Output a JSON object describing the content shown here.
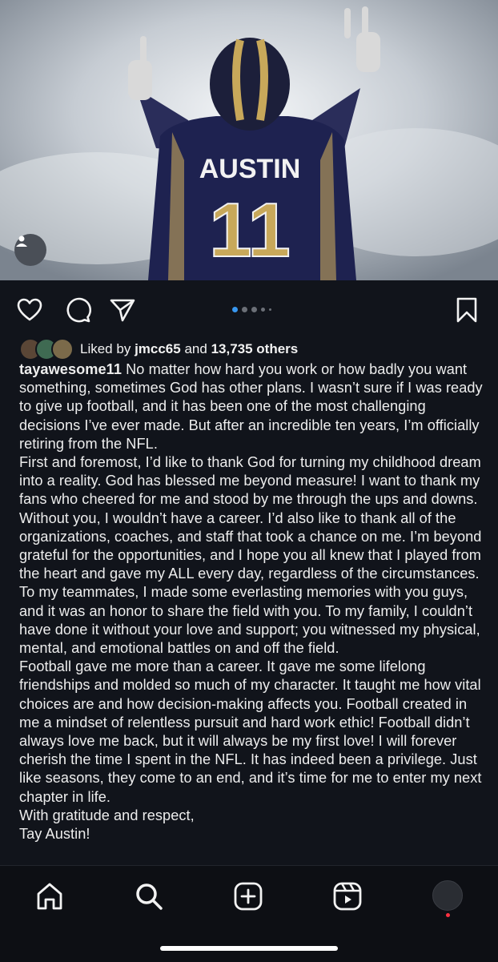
{
  "post": {
    "likes": {
      "prefix": "Liked by",
      "user": "jmcc65",
      "connector": "and",
      "others": "13,735 others"
    },
    "carousel": {
      "total_slides": 5,
      "active_index": 0
    },
    "caption": {
      "username": "tayawesome11",
      "first_paragraph": " No matter how hard you work or how badly you want something, sometimes God has other plans. I wasn’t sure if I was ready to give up football, and it has been one of the most challenging decisions I’ve ever made. But after an incredible ten years, I’m officially retiring from the NFL.",
      "paragraph_2": "First and foremost, I’d like to thank God for turning my childhood dream into a reality. God has blessed me beyond measure! I want to thank my fans who cheered for me and stood by me through the ups and downs. Without you, I wouldn’t have a career.  I’d also like to thank all of the organizations, coaches, and staff that took a chance on me. I’m beyond grateful for the opportunities, and I hope you all knew that I played from the heart and gave my ALL every day, regardless of the circumstances. To my teammates, I made some everlasting memories with you guys, and it was an honor to share the field with you. To my family, I couldn’t have done it without your love and support; you witnessed my physical, mental, and emotional battles on and off the field.",
      "paragraph_3": " Football gave me more than a career. It gave me some lifelong friendships and molded so much of my character. It taught me how vital choices are and how decision-making affects you. Football created in me a mindset of relentless pursuit and hard work ethic! Football didn’t always love me back, but it will always be my first love!  I will forever cherish the time I spent in the NFL. It has indeed been a privilege. Just like seasons, they come to an end, and it’s time for me to enter my next chapter in life.",
      "closing": "With gratitude and respect,",
      "signature": "Tay Austin!"
    },
    "photo": {
      "jersey_name": "AUSTIN",
      "jersey_number": "11"
    }
  },
  "icons": {
    "like": "heart-icon",
    "comment": "comment-bubble-icon",
    "share": "paper-plane-icon",
    "save": "bookmark-icon",
    "tag": "person-tag-icon",
    "tabs": [
      "home-icon",
      "search-icon",
      "create-post-icon",
      "reels-icon",
      "profile-avatar"
    ]
  },
  "colors": {
    "background": "#11141b",
    "accent_dot": "#3897f0",
    "notification": "#ff3040"
  }
}
